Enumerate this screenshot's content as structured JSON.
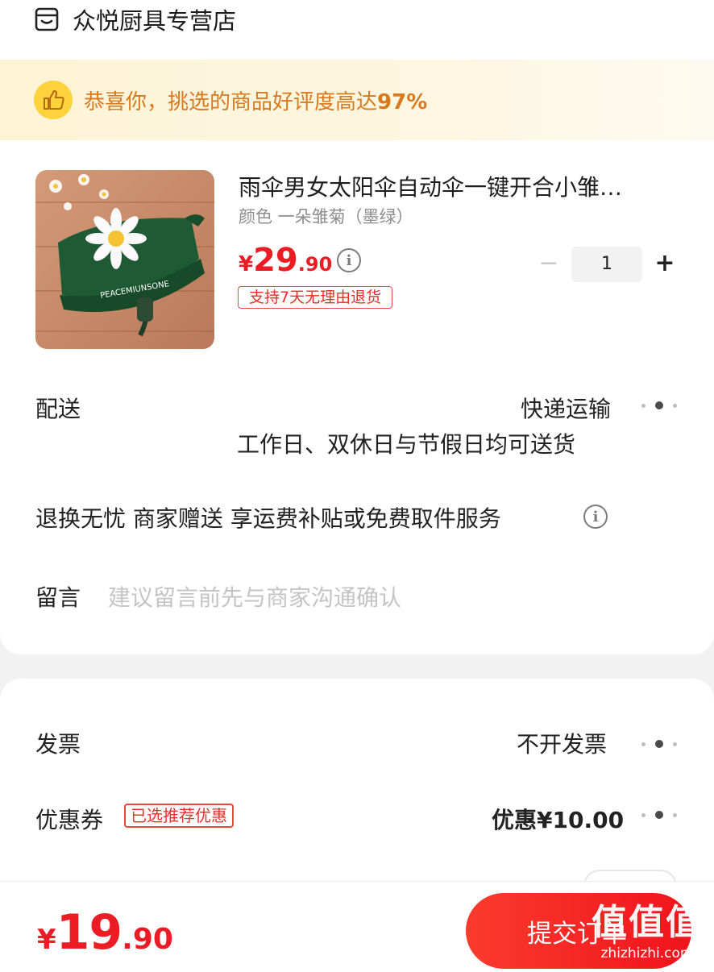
{
  "shop": {
    "name": "众悦厨具专营店",
    "icon": "store-icon"
  },
  "praise_banner": {
    "prefix": "恭喜你，挑选的商品好评度高达",
    "rate": "97%",
    "icon": "thumbs-up-icon"
  },
  "product": {
    "title": "雨伞男女太阳伞自动伞一键开合小雏…",
    "spec": "颜色 一朵雏菊（墨绿）",
    "price": {
      "currency": "¥",
      "integer": "29",
      "decimal": ".90"
    },
    "return_policy": "支持7天无理由退货",
    "quantity": "1",
    "image_text": "PEACEMIUNSONE",
    "minus": "−",
    "plus": "+"
  },
  "delivery": {
    "label": "配送",
    "method": "快递运输",
    "note": "工作日、双休日与节假日均可送货"
  },
  "service": {
    "text": "退换无忧 商家赠送 享运费补贴或免费取件服务"
  },
  "message": {
    "label": "留言",
    "placeholder": "建议留言前先与商家沟通确认"
  },
  "invoice": {
    "label": "发票",
    "value": "不开发票"
  },
  "coupon": {
    "label": "优惠券",
    "badge": "已选推荐优惠",
    "value": "优惠¥10.00"
  },
  "footer": {
    "total": {
      "currency": "¥",
      "integer": "19",
      "decimal": ".90"
    },
    "submit_label": "提交订单"
  },
  "watermark": {
    "big": "值值值",
    "small": "zhizhizhi.com"
  },
  "colors": {
    "price_red": "#ec1c24",
    "praise_orange": "#d7791c",
    "button_red": "#f0131d",
    "badge_yellow": "#fdd23a"
  }
}
